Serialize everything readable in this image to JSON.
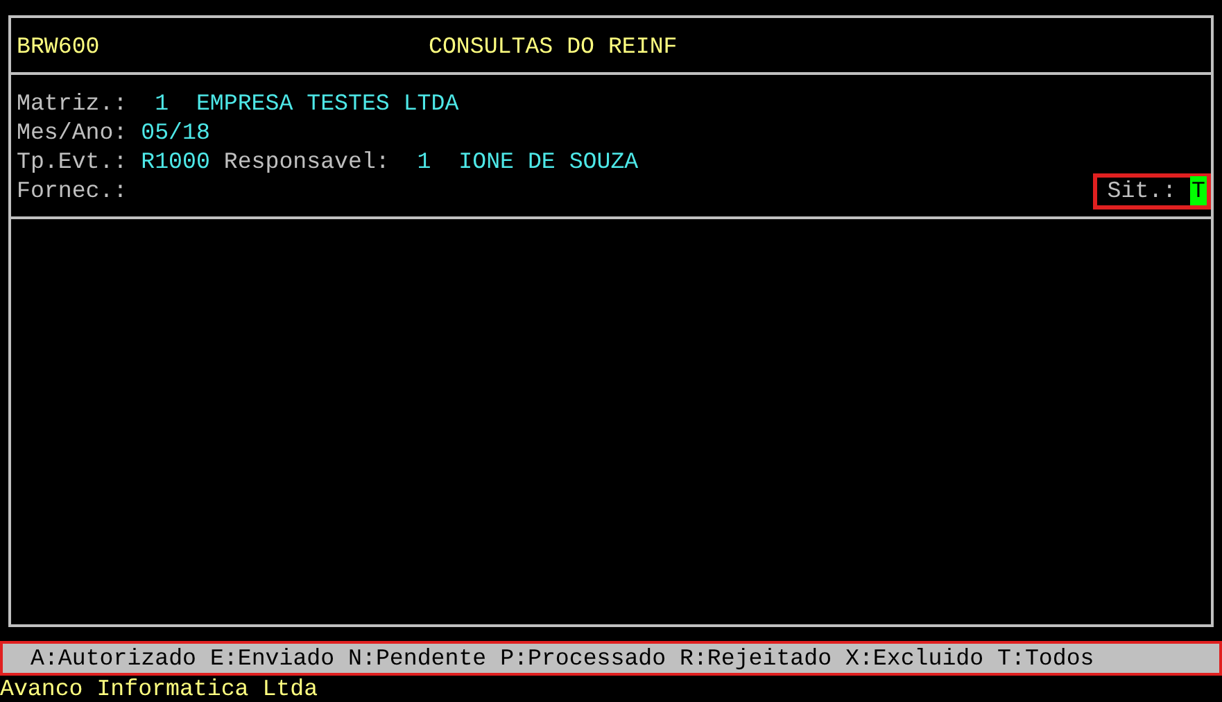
{
  "header": {
    "program": "BRW600",
    "title": "CONSULTAS DO REINF"
  },
  "fields": [
    {
      "segments": [
        {
          "kind": "label",
          "text": "Matriz.:"
        },
        {
          "kind": "code",
          "text": "1"
        },
        {
          "kind": "value",
          "text": "EMPRESA TESTES LTDA"
        }
      ]
    },
    {
      "segments": [
        {
          "kind": "label",
          "text": "Mes/Ano:"
        },
        {
          "kind": "value",
          "text": "05/18"
        }
      ]
    },
    {
      "segments": [
        {
          "kind": "label",
          "text": "Tp.Evt.:"
        },
        {
          "kind": "value",
          "text": "R1000"
        },
        {
          "kind": "label",
          "text": "Responsavel:"
        },
        {
          "kind": "code",
          "text": "1"
        },
        {
          "kind": "value",
          "text": "IONE DE SOUZA"
        }
      ]
    },
    {
      "segments": [
        {
          "kind": "label",
          "text": "Fornec.:"
        }
      ]
    }
  ],
  "situation": {
    "label": "Sit.:",
    "value": "T"
  },
  "legend": "A:Autorizado E:Enviado N:Pendente P:Processado R:Rejeitado X:Excluido T:Todos",
  "footer": "Avanco Informatica Ltda"
}
